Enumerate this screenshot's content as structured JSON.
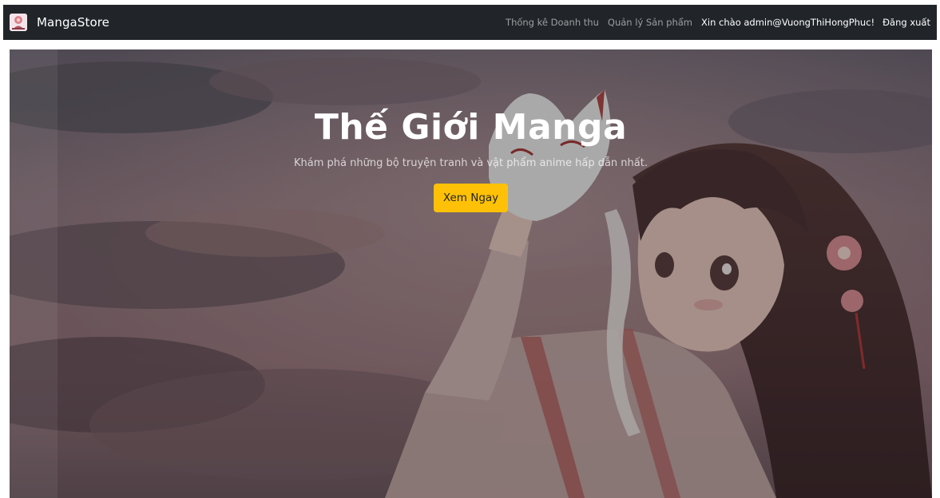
{
  "navbar": {
    "brand": "MangaStore",
    "links": {
      "revenue": "Thống kê Doanh thu",
      "products": "Quản lý Sản phẩm"
    },
    "greeting": "Xin chào admin@VuongThiHongPhuc!",
    "logout": "Đăng xuất"
  },
  "hero": {
    "title": "Thế Giới Manga",
    "subtitle": "Khám phá những bộ truyện tranh và vật phẩm anime hấp dẫn nhất.",
    "button": "Xem Ngay"
  },
  "colors": {
    "navbar_bg": "#212529",
    "cta_bg": "#ffc107"
  },
  "icons": {
    "logo": "brand-logo-icon"
  }
}
